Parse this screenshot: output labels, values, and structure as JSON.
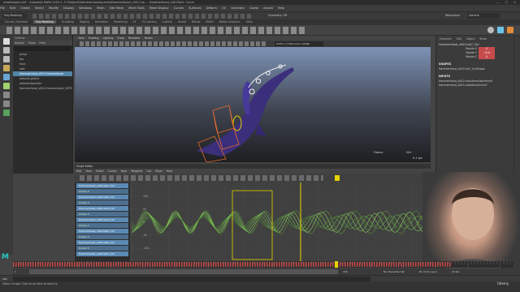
{
  "window": {
    "title": "newSample.ma* - Autodesk MAYA 2023.1: C:\\Projects\\Hammerhead\\scenes\\Hammerhead_v001.ma --- Hammerhead_v001Tail1: Curve",
    "controls": "— ▢ ✕"
  },
  "menubar": [
    "File",
    "Edit",
    "Create",
    "Select",
    "Modify",
    "Display",
    "Windows",
    "Mesh",
    "Edit Mesh",
    "Mesh Tools",
    "Mesh Display",
    "Curves",
    "Surfaces",
    "Deform",
    "UV",
    "Generate",
    "Cache",
    "Arnold",
    "Help"
  ],
  "statusline": {
    "mode": "Poly Modeling",
    "symmetry": "Symmetry: Off",
    "workspace_label": "Workspace:",
    "workspace": "General"
  },
  "shelf_tabs": {
    "items": [
      "Curves / Surfaces",
      "Poly Modeling",
      "Sculpting",
      "Rigging",
      "Animation",
      "Rendering",
      "FX",
      "FX Caching",
      "Custom",
      "Arnold",
      "Bifrost",
      "MASH",
      "Motion Graphics",
      "XGen"
    ],
    "active": "Poly Modeling"
  },
  "outliner": {
    "title": "Outliner",
    "menu": [
      "Display",
      "Show",
      "Help"
    ],
    "items": [
      "persp",
      "top",
      "front",
      "side",
      "Hammerhead_v001:Hammerhead",
      "defaultLightSet",
      "defaultObjectSet",
      "Hammerhead_v001:Hammerhead_VISTERN"
    ],
    "selected_index": 4
  },
  "viewport": {
    "menu": [
      "View",
      "Shading",
      "Lighting",
      "Show",
      "Renderer",
      "Panels"
    ],
    "camera_field": "ACES 1.0 SDR-video (sRGB)",
    "frame_label": "Frame:",
    "frame_value": "241",
    "fps": "0.1 fps"
  },
  "channel_box": {
    "tabs": [
      "Channels",
      "Edit",
      "Object",
      "Show"
    ],
    "object": "Hammerhead_v001:tail7_Ctrl",
    "attributes": [
      {
        "name": "Rotate X",
        "value": "0"
      },
      {
        "name": "Rotate Y",
        "value": "-10.6"
      },
      {
        "name": "Rotate Z",
        "value": "0"
      }
    ],
    "shapes_title": "SHAPES",
    "shapes": [
      "Hammerhead_v001:tail7_CtrlShape"
    ],
    "inputs_title": "INPUTS",
    "inputs": [
      "Hammerhead_v001:transformGeometry8",
      "Hammerhead_v001:makeNurbCircle7"
    ]
  },
  "graph_editor": {
    "title": "Graph Editor",
    "menu": [
      "Edit",
      "View",
      "Select",
      "Curves",
      "Keys",
      "Tangents",
      "List",
      "Show",
      "Help"
    ],
    "frame_start": "1",
    "frame_end": "400",
    "channels": [
      {
        "label": "Hammerhead_v001:tail1_Ctrl",
        "kind": "obj"
      },
      {
        "label": "Rotate X",
        "kind": "attr"
      },
      {
        "label": "Hammerhead_v001:tail2_Ctrl",
        "kind": "obj"
      },
      {
        "label": "Rotate X",
        "kind": "attr"
      },
      {
        "label": "Hammerhead_v001:tail3_Ctrl",
        "kind": "obj"
      },
      {
        "label": "Rotate X",
        "kind": "attr"
      },
      {
        "label": "Hammerhead_v001:tail4_Ctrl",
        "kind": "obj"
      },
      {
        "label": "Rotate X",
        "kind": "attr"
      },
      {
        "label": "Hammerhead_v001:tail5_Ctrl",
        "kind": "obj"
      },
      {
        "label": "Rotate X",
        "kind": "attr"
      },
      {
        "label": "Hammerhead_v001:tail6_Ctrl",
        "kind": "obj"
      },
      {
        "label": "Rotate X",
        "kind": "attr"
      },
      {
        "label": "Hammerhead_v001:tail7_Ctrl",
        "kind": "obj"
      }
    ],
    "y_ticks": [
      "100",
      "50",
      "0",
      "-50",
      "-100"
    ]
  },
  "timeline": {
    "start": "1",
    "end": "240",
    "current": "241",
    "character_set": "No Character Set",
    "anim_layer": "No Anim Layer",
    "fps": "24 fps"
  },
  "command": {
    "prefix": "MEL"
  },
  "help_line": "Select: Graph: Click on an item to select it.",
  "brand": {
    "logo": "M",
    "watermark": "Udemy"
  },
  "colors": {
    "selection_blue": "#5285a6",
    "curve_green": "#6fb04a",
    "key_yellow": "#e6d400",
    "keyed_red": "#c64b4b",
    "logo_cyan": "#27c4c4"
  }
}
